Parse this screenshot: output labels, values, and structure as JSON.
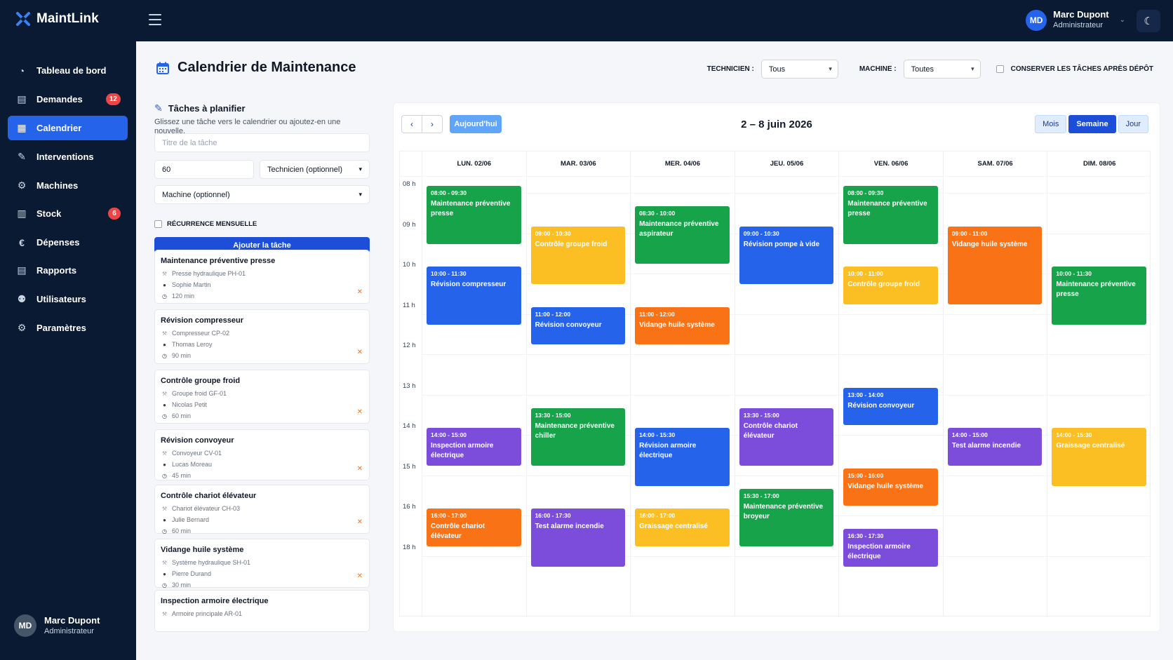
{
  "app": {
    "name": "MaintLink"
  },
  "topbar": {
    "user_initials": "MD",
    "user_name": "Marc Dupont",
    "user_role": "Administrateur"
  },
  "sidebar": {
    "items": [
      {
        "label": "Tableau de bord",
        "icon": "dashboard-icon",
        "glyph": "◔"
      },
      {
        "label": "Demandes",
        "icon": "clipboard-icon",
        "glyph": "▤",
        "badge": "12"
      },
      {
        "label": "Calendrier",
        "icon": "calendar-icon",
        "glyph": "▦"
      },
      {
        "label": "Interventions",
        "icon": "wrench-icon",
        "glyph": "✎"
      },
      {
        "label": "Machines",
        "icon": "gears-icon",
        "glyph": "⚙"
      },
      {
        "label": "Stock",
        "icon": "boxes-icon",
        "glyph": "▥",
        "badge": "6"
      },
      {
        "label": "Dépenses",
        "icon": "euro-icon",
        "glyph": "€"
      },
      {
        "label": "Rapports",
        "icon": "report-icon",
        "glyph": "▤"
      },
      {
        "label": "Utilisateurs",
        "icon": "users-icon",
        "glyph": "⚉"
      },
      {
        "label": "Paramètres",
        "icon": "settings-icon",
        "glyph": "⚙"
      }
    ],
    "user": {
      "initials": "MD",
      "name": "Marc Dupont",
      "role": "Administrateur"
    }
  },
  "page": {
    "title": "Calendrier de Maintenance"
  },
  "filters": {
    "technician_label": "TECHNICIEN :",
    "technician_value": "Tous",
    "machine_label": "MACHINE :",
    "machine_value": "Toutes",
    "keep_label": "CONSERVER LES TÂCHES APRÈS DÉPÔT"
  },
  "planner": {
    "title": "Tâches à planifier",
    "description": "Glissez une tâche vers le calendrier ou ajoutez-en une nouvelle.",
    "title_placeholder": "Titre de la tâche",
    "duration_value": "60",
    "technician_placeholder": "Technicien (optionnel)",
    "machine_placeholder": "Machine (optionnel)",
    "recurrence_label": "RÉCURRENCE MENSUELLE",
    "add_button": "Ajouter la tâche",
    "tasks": [
      {
        "title": "Maintenance préventive presse",
        "machine": "Presse hydraulique PH-01",
        "technician": "Sophie Martin",
        "duration": "120 min"
      },
      {
        "title": "Révision compresseur",
        "machine": "Compresseur CP-02",
        "technician": "Thomas Leroy",
        "duration": "90 min"
      },
      {
        "title": "Contrôle groupe froid",
        "machine": "Groupe froid GF-01",
        "technician": "Nicolas Petit",
        "duration": "60 min"
      },
      {
        "title": "Révision convoyeur",
        "machine": "Convoyeur CV-01",
        "technician": "Lucas Moreau",
        "duration": "45 min"
      },
      {
        "title": "Contrôle chariot élévateur",
        "machine": "Chariot élévateur CH-03",
        "technician": "Julie Bernard",
        "duration": "60 min"
      },
      {
        "title": "Vidange huile système",
        "machine": "Système hydraulique SH-01",
        "technician": "Pierre Durand",
        "duration": "30 min"
      },
      {
        "title": "Inspection armoire électrique",
        "machine": "Armoire principale AR-01",
        "technician": "",
        "duration": ""
      }
    ]
  },
  "calendar": {
    "today_button": "Aujourd'hui",
    "range": "2 – 8 juin 2026",
    "views": [
      "Mois",
      "Semaine",
      "Jour"
    ],
    "active_view": "Semaine",
    "days": [
      "LUN. 02/06",
      "MAR. 03/06",
      "MER. 04/06",
      "JEU. 05/06",
      "VEN. 06/06",
      "SAM. 07/06",
      "DIM. 08/06"
    ],
    "hours": [
      "08 h",
      "09 h",
      "10 h",
      "11 h",
      "12 h",
      "13 h",
      "14 h",
      "15 h",
      "16 h",
      "18 h"
    ],
    "colors": {
      "green": "#16a34a",
      "yellow": "#fbbf24",
      "blue": "#2563eb",
      "orange": "#f97316",
      "purple": "#7c4ddb"
    },
    "events": [
      {
        "day": 0,
        "start": 8.0,
        "end": 9.5,
        "time": "08:00 - 09:30",
        "title": "Maintenance préventive presse",
        "color": "green"
      },
      {
        "day": 0,
        "start": 10.0,
        "end": 11.5,
        "time": "10:00 - 11:30",
        "title": "Révision compresseur",
        "color": "blue"
      },
      {
        "day": 0,
        "start": 14.0,
        "end": 15.0,
        "time": "14:00 - 15:00",
        "title": "Inspection armoire électrique",
        "color": "purple"
      },
      {
        "day": 0,
        "start": 16.0,
        "end": 17.0,
        "time": "16:00 - 17:00",
        "title": "Contrôle chariot élévateur",
        "color": "orange"
      },
      {
        "day": 1,
        "start": 9.0,
        "end": 10.5,
        "time": "09:00 - 10:30",
        "title": "Contrôle groupe froid",
        "color": "yellow"
      },
      {
        "day": 1,
        "start": 11.0,
        "end": 12.0,
        "time": "11:00 - 12:00",
        "title": "Révision convoyeur",
        "color": "blue"
      },
      {
        "day": 1,
        "start": 13.5,
        "end": 15.0,
        "time": "13:30 - 15:00",
        "title": "Maintenance préventive chiller",
        "color": "green"
      },
      {
        "day": 1,
        "start": 16.0,
        "end": 17.5,
        "time": "16:00 - 17:30",
        "title": "Test alarme incendie",
        "color": "purple"
      },
      {
        "day": 2,
        "start": 8.5,
        "end": 10.0,
        "time": "08:30 - 10:00",
        "title": "Maintenance préventive aspirateur",
        "color": "green"
      },
      {
        "day": 2,
        "start": 11.0,
        "end": 12.0,
        "time": "11:00 - 12:00",
        "title": "Vidange huile système",
        "color": "orange"
      },
      {
        "day": 2,
        "start": 14.0,
        "end": 15.5,
        "time": "14:00 - 15:30",
        "title": "Révision armoire électrique",
        "color": "blue"
      },
      {
        "day": 2,
        "start": 16.0,
        "end": 17.0,
        "time": "16:00 - 17:00",
        "title": "Graissage centralisé",
        "color": "yellow"
      },
      {
        "day": 3,
        "start": 9.0,
        "end": 10.5,
        "time": "09:00 - 10:30",
        "title": "Révision pompe à vide",
        "color": "blue"
      },
      {
        "day": 3,
        "start": 13.5,
        "end": 15.0,
        "time": "13:30 - 15:00",
        "title": "Contrôle chariot élévateur",
        "color": "purple"
      },
      {
        "day": 3,
        "start": 15.5,
        "end": 17.0,
        "time": "15:30 - 17:00",
        "title": "Maintenance préventive broyeur",
        "color": "green"
      },
      {
        "day": 4,
        "start": 8.0,
        "end": 9.5,
        "time": "08:00 - 09:30",
        "title": "Maintenance préventive presse",
        "color": "green"
      },
      {
        "day": 4,
        "start": 10.0,
        "end": 11.0,
        "time": "10:00 - 11:00",
        "title": "Contrôle groupe froid",
        "color": "yellow"
      },
      {
        "day": 4,
        "start": 13.0,
        "end": 14.0,
        "time": "13:00 - 14:00",
        "title": "Révision convoyeur",
        "color": "blue"
      },
      {
        "day": 4,
        "start": 15.0,
        "end": 16.0,
        "time": "15:00 - 16:00",
        "title": "Vidange huile système",
        "color": "orange"
      },
      {
        "day": 4,
        "start": 16.5,
        "end": 17.5,
        "time": "16:30 - 17:30",
        "title": "Inspection armoire électrique",
        "color": "purple"
      },
      {
        "day": 5,
        "start": 9.0,
        "end": 11.0,
        "time": "09:00 - 11:00",
        "title": "Vidange huile système",
        "color": "orange"
      },
      {
        "day": 5,
        "start": 14.0,
        "end": 15.0,
        "time": "14:00 - 15:00",
        "title": "Test alarme incendie",
        "color": "purple"
      },
      {
        "day": 6,
        "start": 10.0,
        "end": 11.5,
        "time": "10:00 - 11:30",
        "title": "Maintenance préventive presse",
        "color": "green"
      },
      {
        "day": 6,
        "start": 14.0,
        "end": 15.5,
        "time": "14:00 - 15:30",
        "title": "Graissage centralisé",
        "color": "yellow"
      }
    ]
  }
}
